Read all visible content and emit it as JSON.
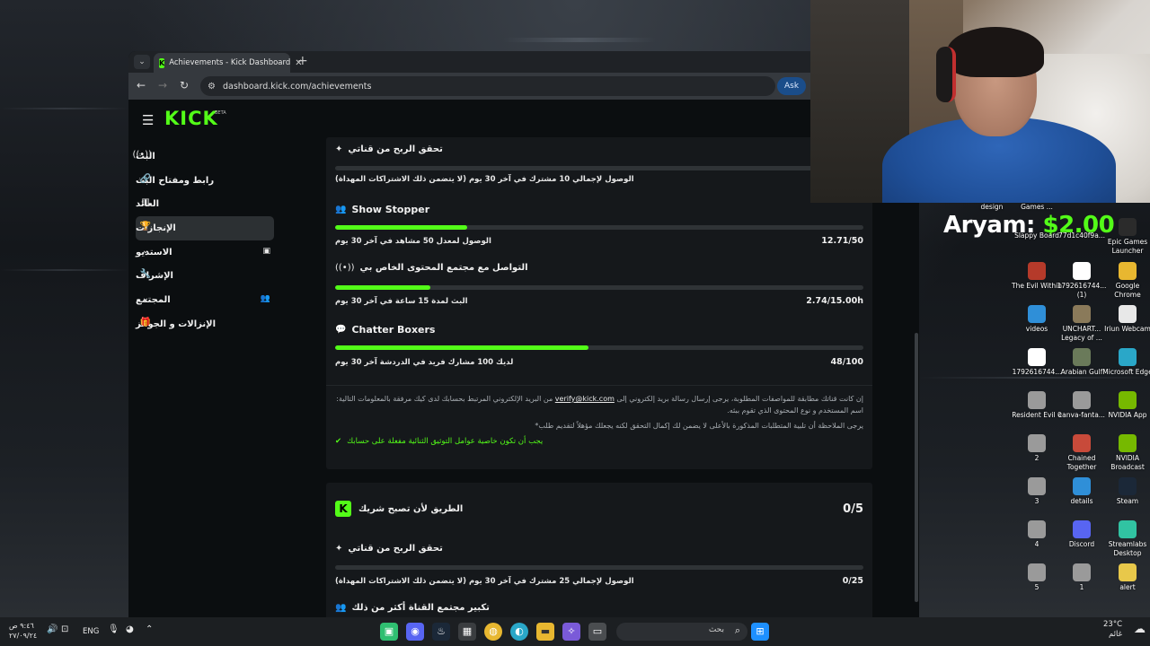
{
  "browser": {
    "tab_title": "Achievements - Kick Dashboard",
    "url": "dashboard.kick.com/achievements",
    "ask_label": "Ask",
    "tab_favicon": "K"
  },
  "kick": {
    "logo": "KICK",
    "logo_badge": "BETA",
    "brand_color": "#53fc18"
  },
  "sidebar": {
    "items": [
      {
        "label": "البث",
        "icon": "broadcast-icon"
      },
      {
        "label": "رابط ومفتاح البث",
        "icon": "link-icon"
      },
      {
        "label": "العائد",
        "icon": "chart-icon"
      },
      {
        "label": "الإنجازات",
        "icon": "trophy-icon",
        "active": true
      },
      {
        "label": "الاستديو",
        "icon": "chevron-down-icon"
      },
      {
        "label": "الإشراف",
        "icon": "wrench-icon"
      },
      {
        "label": "المجتمع",
        "icon": "chevron-down-icon"
      },
      {
        "label": "الإنزالات و الجوائز",
        "icon": "gift-icon"
      }
    ]
  },
  "card1": {
    "monetize_title": "تحقق الربح من قناتي",
    "monetize_desc": "الوصول لإجمالي 10 مشترك في آخر 30 يوم (لا يتضمن ذلك الاشتراكات المهداة)",
    "achievements": [
      {
        "title": "Show Stopper",
        "desc": "الوصول لمعدل 50 مشاهد في آخر 30 يوم",
        "value": "12.71/50",
        "progress": 0.25
      },
      {
        "title": "التواصل مع مجتمع المحتوى الخاص بي",
        "desc": "البث لمدة 15 ساعة في آخر 30 يوم",
        "value": "2.74/15.00h",
        "progress": 0.18
      },
      {
        "title": "Chatter Boxers",
        "desc": "لديك 100 مشارك فريد في الدردشة آخر 30 يوم",
        "value": "48/100",
        "progress": 0.48
      }
    ],
    "note_line1_a": "إن كانت قناتك مطابقة للمواصفات المطلوبة، يرجى إرسال رسالة بريد إلكتروني إلى",
    "note_email": "verify@kick.com",
    "note_line1_b": "من البريد الإلكتروني المرتبط بحسابك لدى كيك مرفقة بالمعلومات التالية: اسم المستخدم و نوع المحتوى الذي تقوم ببثه.",
    "note_line2": "يرجى الملاحظة أن تلبية المتطلبات المذكورة بالأعلى لا يضمن لك إكمال التحقق لكنه يجعلك مؤهلاً لتقديم طلب*",
    "note_check": "يجب أن تكون خاصية عوامل التوثيق الثنائية مفعلة على حسابك"
  },
  "card2": {
    "title": "الطريق لأن تصبح شريك",
    "count": "0/5",
    "monetize_title": "تحقق الربح من قناتي",
    "monetize_desc": "الوصول لإجمالي 25 مشترك في آخر 30 يوم (لا يتضمن ذلك الاشتراكات المهداة)",
    "monetize_value": "0/25",
    "grow_title": "تكبير مجتمع القناة أكثر من ذلك"
  },
  "overlay": {
    "name": "Aryam",
    "separator": ":",
    "amount": "$2.00"
  },
  "desktop_icons": [
    {
      "label": "design",
      "color": "#3a5f8a"
    },
    {
      "label": "Games ...",
      "color": "#4a4a4a"
    },
    {
      "label": "Slappy Board",
      "color": "#7a6a4a"
    },
    {
      "label": "77d1c40f9a...",
      "color": "#ffffff"
    },
    {
      "label": "Epic Games Launcher",
      "color": "#2b2b2b"
    },
    {
      "label": "The Evil Within",
      "color": "#b53a2a"
    },
    {
      "label": "1792616744... (1)",
      "color": "#ffffff"
    },
    {
      "label": "Google Chrome",
      "color": "#e8b730"
    },
    {
      "label": "videos",
      "color": "#2f8fd8"
    },
    {
      "label": "UNCHART... Legacy of ...",
      "color": "#8a7a5a"
    },
    {
      "label": "Iriun Webcam",
      "color": "#e8e8e8"
    },
    {
      "label": "1792616744...",
      "color": "#ffffff"
    },
    {
      "label": "Arabian Gulf",
      "color": "#6a7a5a"
    },
    {
      "label": "Microsoft Edge",
      "color": "#2aa7c8"
    },
    {
      "label": "Resident Evil 0",
      "color": "#9a9a9a"
    },
    {
      "label": "canva-fanta...",
      "color": "#9a9a9a"
    },
    {
      "label": "NVIDIA App",
      "color": "#76b900"
    },
    {
      "label": "2",
      "color": "#9a9a9a"
    },
    {
      "label": "Chained Together",
      "color": "#c84a3a"
    },
    {
      "label": "NVIDIA Broadcast",
      "color": "#76b900"
    },
    {
      "label": "3",
      "color": "#9a9a9a"
    },
    {
      "label": "details",
      "color": "#2f8fd8"
    },
    {
      "label": "Steam",
      "color": "#1b2838"
    },
    {
      "label": "4",
      "color": "#9a9a9a"
    },
    {
      "label": "Discord",
      "color": "#5865f2"
    },
    {
      "label": "Streamlabs Desktop",
      "color": "#31c3a2"
    },
    {
      "label": "5",
      "color": "#9a9a9a"
    },
    {
      "label": "1",
      "color": "#9a9a9a"
    },
    {
      "label": "alert",
      "color": "#e8c84a"
    }
  ],
  "taskbar": {
    "time": "٩:٤٦ ص",
    "date": "٢٧/٠٩/٢٤",
    "lang": "ENG",
    "search_placeholder": "بحث",
    "temp": "23°C",
    "weather": "غائم"
  }
}
